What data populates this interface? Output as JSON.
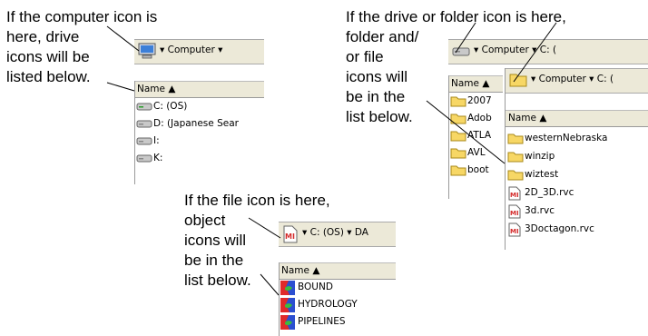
{
  "captions": {
    "computer": [
      "If the computer icon is",
      "here, drive",
      "icons will be",
      "listed below."
    ],
    "drive": [
      "If the drive or folder icon is here,",
      "folder and/",
      "or file",
      "icons will",
      "be in the",
      "list below."
    ],
    "file": [
      "If the file icon is here,",
      "object",
      "icons will",
      "be in the",
      "list below."
    ]
  },
  "computer_panel": {
    "crumb": "▾ Computer ▾",
    "column_header": "Name ▲",
    "items": [
      "C: (OS)",
      "D: (Japanese Sear",
      "I:",
      "K:"
    ]
  },
  "drive_panel_back": {
    "crumb": "▾ Computer ▾ C: (",
    "column_header": "Name ▲",
    "items": [
      "2007",
      "Adob",
      "ATLA",
      "AVL",
      "boot"
    ]
  },
  "drive_panel_front": {
    "crumb": "▾ Computer ▾ C: (",
    "column_header": "Name ▲",
    "items": [
      "westernNebraska",
      "winzip",
      "wiztest",
      "2D_3D.rvc",
      "3d.rvc",
      "3Doctagon.rvc"
    ]
  },
  "file_panel": {
    "crumb": "▾ C: (OS) ▾ DA",
    "column_header": "Name ▲",
    "items": [
      "BOUND",
      "HYDROLOGY",
      "PIPELINES"
    ]
  },
  "icons": {
    "computer": "computer-icon",
    "drive": "drive-icon",
    "folder": "folder-icon",
    "file": "rvc-file-icon",
    "object": "raster-object-icon"
  },
  "colors": {
    "toolbar": "#ece9d8",
    "folder": "#f7d765",
    "file_mark": "#d42a2a"
  }
}
